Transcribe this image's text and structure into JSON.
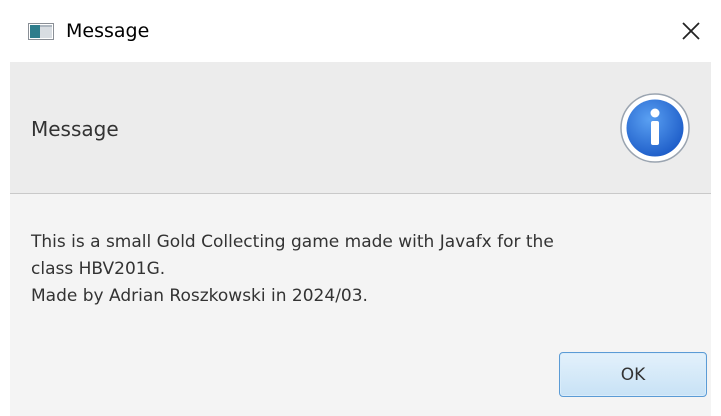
{
  "window": {
    "title": "Message"
  },
  "dialog": {
    "header_text": "Message",
    "content_lines": [
      "This is a small Gold Collecting game made with Javafx for the",
      "class HBV201G.",
      "Made by Adrian Roszkowski in 2024/03."
    ],
    "ok_label": "OK",
    "icon": "information-icon"
  },
  "colors": {
    "header_background": "#ececec",
    "content_background": "#f4f4f4",
    "info_icon_blue": "#2f6fd6",
    "ok_button_border": "#5b9bd5"
  }
}
